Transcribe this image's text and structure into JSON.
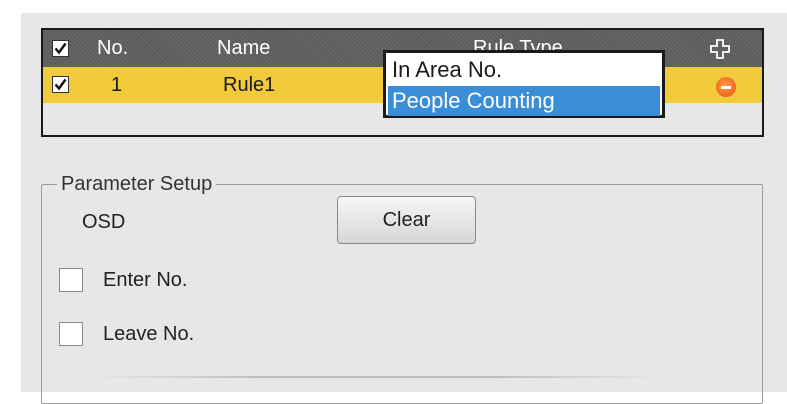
{
  "rule_table": {
    "header": {
      "select_all_checked": true,
      "col_no": "No.",
      "col_name": "Name",
      "col_rule_type": "Rule Type",
      "add_icon": "plus-outline-icon"
    },
    "rows": [
      {
        "checked": true,
        "no": "1",
        "name": "Rule1",
        "rule_type": "People Counting",
        "remove_icon": "minus-circle-icon"
      }
    ],
    "selected_row_color": "#f1cb3c",
    "header_color": "#666666"
  },
  "rule_type_dropdown": {
    "options": [
      "In Area No.",
      "People Counting"
    ],
    "selected": "People Counting",
    "highlight_color": "#3a8ed8"
  },
  "parameter_setup": {
    "legend": "Parameter Setup",
    "osd_label": "OSD",
    "clear_label": "Clear",
    "enter_label": "Enter No.",
    "enter_checked": false,
    "leave_label": "Leave No.",
    "leave_checked": false
  },
  "colors": {
    "panel_bg": "#e7e7e7",
    "remove_icon": "#f06818"
  }
}
